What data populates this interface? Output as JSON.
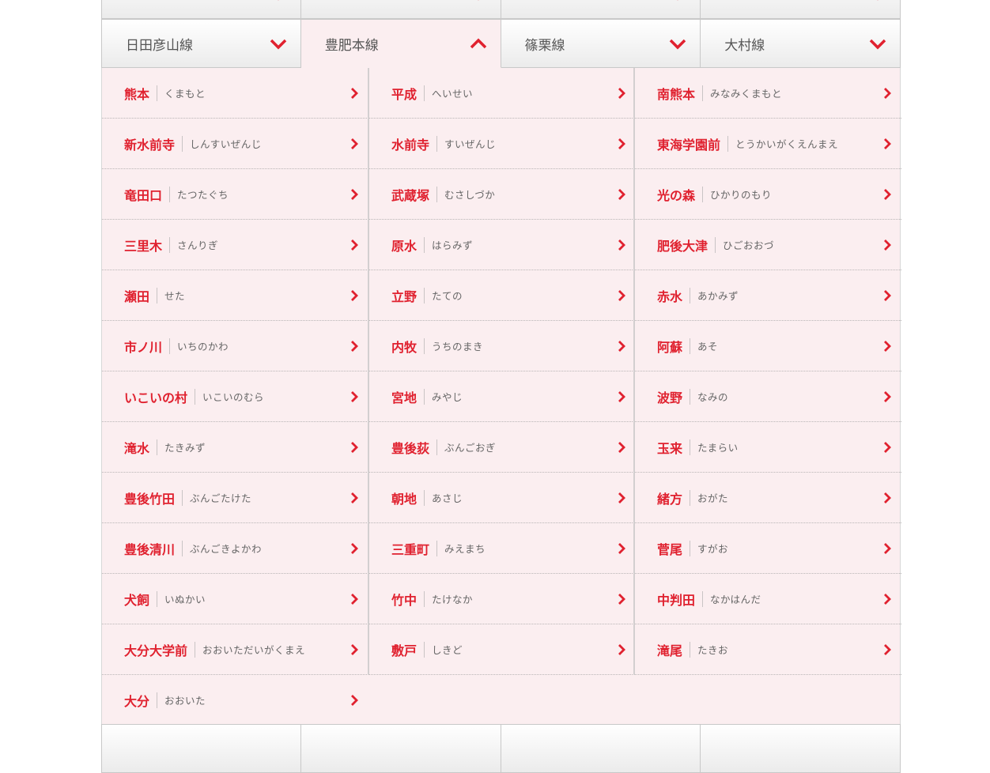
{
  "tabs_top": [
    "",
    "",
    "",
    ""
  ],
  "tabs": [
    {
      "label": "日田彦山線",
      "state": "collapsed"
    },
    {
      "label": "豊肥本線",
      "state": "expanded"
    },
    {
      "label": "篠栗線",
      "state": "collapsed"
    },
    {
      "label": "大村線",
      "state": "collapsed"
    }
  ],
  "tabs_bottom": [
    "",
    "",
    "",
    ""
  ],
  "stations": {
    "col0": [
      {
        "name": "熊本",
        "kana": "くまもと"
      },
      {
        "name": "新水前寺",
        "kana": "しんすいぜんじ"
      },
      {
        "name": "竜田口",
        "kana": "たつたぐち"
      },
      {
        "name": "三里木",
        "kana": "さんりぎ"
      },
      {
        "name": "瀬田",
        "kana": "せた"
      },
      {
        "name": "市ノ川",
        "kana": "いちのかわ"
      },
      {
        "name": "いこいの村",
        "kana": "いこいのむら"
      },
      {
        "name": "滝水",
        "kana": "たきみず"
      },
      {
        "name": "豊後竹田",
        "kana": "ぶんごたけた"
      },
      {
        "name": "豊後清川",
        "kana": "ぶんごきよかわ"
      },
      {
        "name": "犬飼",
        "kana": "いぬかい"
      },
      {
        "name": "大分大学前",
        "kana": "おおいただいがくまえ"
      },
      {
        "name": "大分",
        "kana": "おおいた"
      }
    ],
    "col1": [
      {
        "name": "平成",
        "kana": "へいせい"
      },
      {
        "name": "水前寺",
        "kana": "すいぜんじ"
      },
      {
        "name": "武蔵塚",
        "kana": "むさしづか"
      },
      {
        "name": "原水",
        "kana": "はらみず"
      },
      {
        "name": "立野",
        "kana": "たての"
      },
      {
        "name": "内牧",
        "kana": "うちのまき"
      },
      {
        "name": "宮地",
        "kana": "みやじ"
      },
      {
        "name": "豊後荻",
        "kana": "ぶんごおぎ"
      },
      {
        "name": "朝地",
        "kana": "あさじ"
      },
      {
        "name": "三重町",
        "kana": "みえまち"
      },
      {
        "name": "竹中",
        "kana": "たけなか"
      },
      {
        "name": "敷戸",
        "kana": "しきど"
      }
    ],
    "col2": [
      {
        "name": "南熊本",
        "kana": "みなみくまもと"
      },
      {
        "name": "東海学園前",
        "kana": "とうかいがくえんまえ"
      },
      {
        "name": "光の森",
        "kana": "ひかりのもり"
      },
      {
        "name": "肥後大津",
        "kana": "ひごおおづ"
      },
      {
        "name": "赤水",
        "kana": "あかみず"
      },
      {
        "name": "阿蘇",
        "kana": "あそ"
      },
      {
        "name": "波野",
        "kana": "なみの"
      },
      {
        "name": "玉来",
        "kana": "たまらい"
      },
      {
        "name": "緒方",
        "kana": "おがた"
      },
      {
        "name": "菅尾",
        "kana": "すがお"
      },
      {
        "name": "中判田",
        "kana": "なかはんだ"
      },
      {
        "name": "滝尾",
        "kana": "たきお"
      }
    ]
  },
  "colors": {
    "accent": "#e0212f",
    "panel_bg": "#fbeef0",
    "kana": "#666666"
  },
  "icons": {
    "tab_collapsed": "chevron-down-icon",
    "tab_expanded": "chevron-up-icon",
    "item": "chevron-right-icon"
  }
}
